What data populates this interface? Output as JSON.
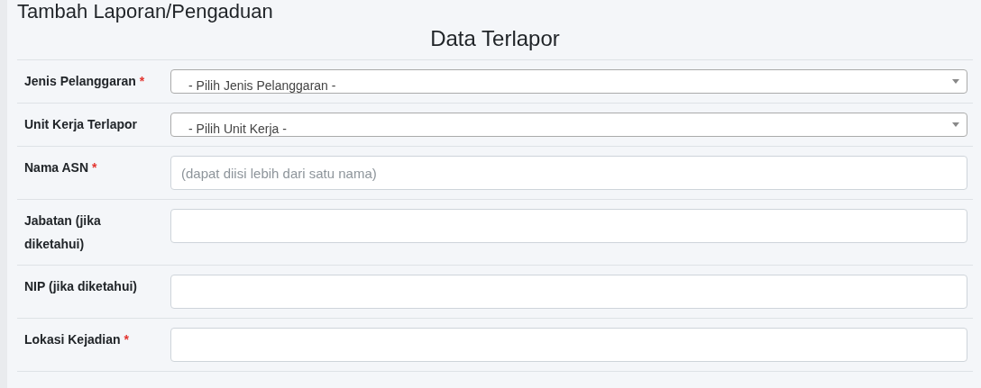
{
  "page_title": "Tambah Laporan/Pengaduan",
  "section_title": "Data Terlapor",
  "fields": [
    {
      "kind": "select",
      "label": "Jenis Pelanggaran",
      "required_mark": "*",
      "value": "- Pilih Jenis Pelanggaran -"
    },
    {
      "kind": "select",
      "label": "Unit Kerja Terlapor",
      "value": "- Pilih Unit Kerja -"
    },
    {
      "kind": "input",
      "label": "Nama ASN",
      "required_mark": "*",
      "placeholder": "(dapat diisi lebih dari satu nama)"
    },
    {
      "kind": "input",
      "label": "Jabatan (jika diketahui)"
    },
    {
      "kind": "input",
      "label": "NIP (jika diketahui)"
    },
    {
      "kind": "input",
      "label": "Lokasi Kejadian",
      "required_mark": "*"
    }
  ]
}
